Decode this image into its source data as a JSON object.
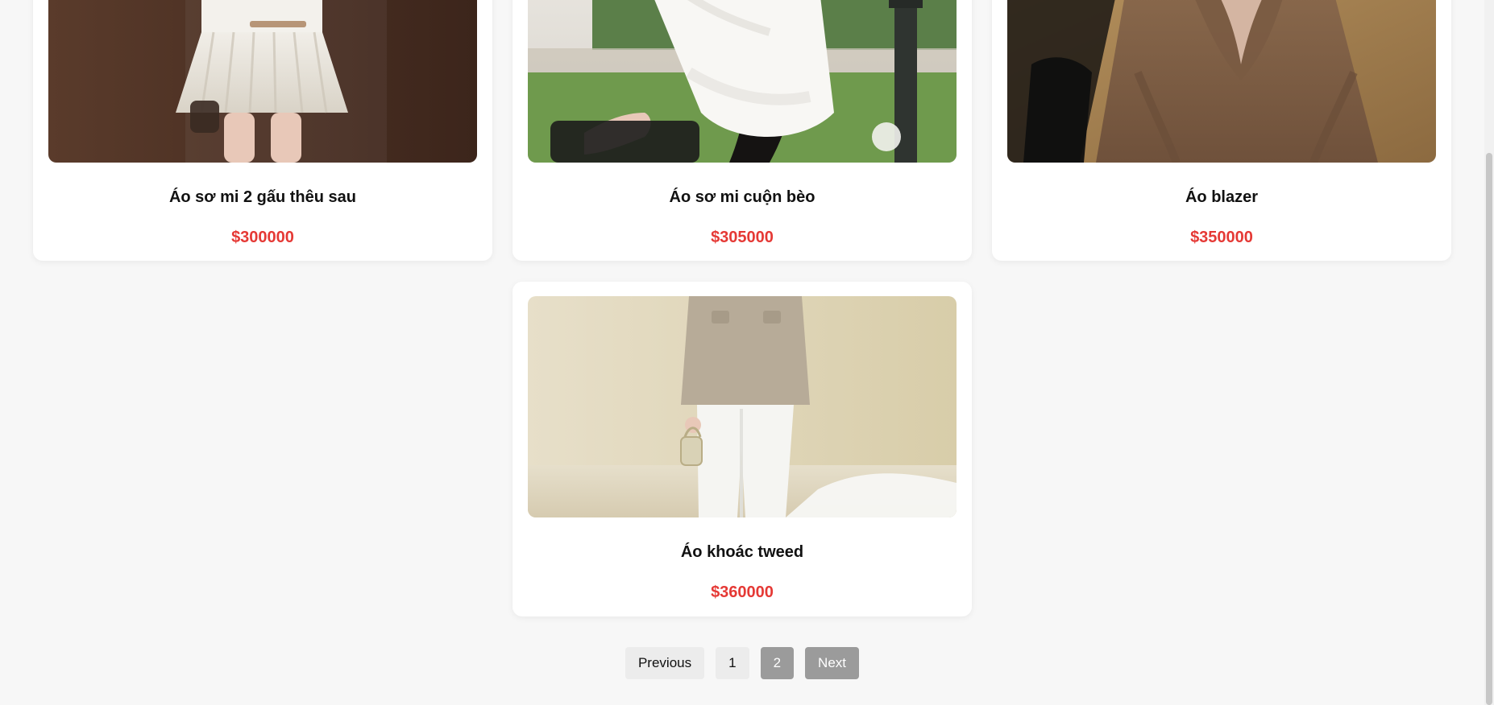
{
  "products": {
    "top_row": [
      {
        "name": "Áo sơ mi 2 gấu thêu sau",
        "price": "$300000",
        "image": "product-photo-white-shirt-skirt"
      },
      {
        "name": "Áo sơ mi cuộn bèo",
        "price": "$305000",
        "image": "product-photo-ruffled-blouse"
      },
      {
        "name": "Áo blazer",
        "price": "$350000",
        "image": "product-photo-brown-blazer"
      }
    ],
    "bottom_row": [
      {
        "name": "Áo khoác tweed",
        "price": "$360000",
        "image": "product-photo-tweed-jacket-white-pants"
      }
    ]
  },
  "pagination": {
    "previous": "Previous",
    "pages": [
      "1",
      "2"
    ],
    "current_page": "2",
    "next": "Next"
  },
  "colors": {
    "background": "#f7f7f7",
    "card": "#ffffff",
    "price": "#e53935",
    "pagination_active": "#9b9b9b",
    "pagination_default": "#ececec"
  }
}
